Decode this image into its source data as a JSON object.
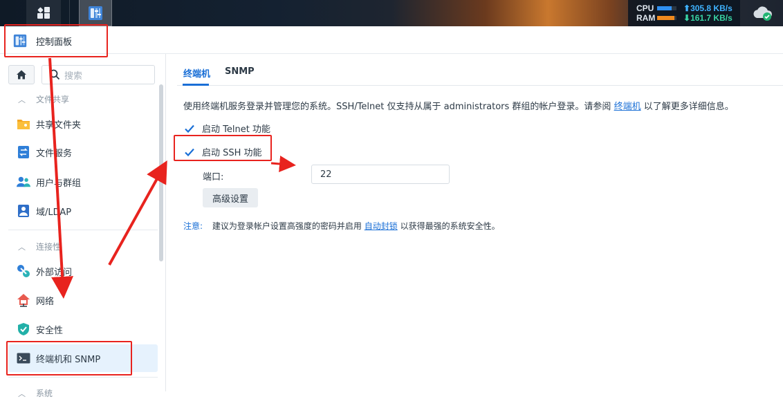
{
  "taskbar": {
    "monitor": {
      "cpu_label": "CPU",
      "ram_label": "RAM",
      "upload_rate": "305.8 KB/s",
      "download_rate": "161.7 KB/s",
      "cpu_fill": 0.75,
      "ram_fill": 0.9
    },
    "icons": [
      "apps-grid-icon",
      "control-panel-icon",
      "cloud-sync-icon"
    ]
  },
  "window": {
    "title": "控制面板"
  },
  "sidebar": {
    "search_placeholder": "搜索",
    "groups": [
      {
        "label": "文件共享"
      },
      {
        "label": "连接性"
      },
      {
        "label": "系统"
      }
    ],
    "items": [
      {
        "label": "共享文件夹",
        "icon": "shared-folder-icon"
      },
      {
        "label": "文件服务",
        "icon": "file-services-icon"
      },
      {
        "label": "用户与群组",
        "icon": "users-icon"
      },
      {
        "label": "域/LDAP",
        "icon": "domain-icon"
      },
      {
        "label": "外部访问",
        "icon": "external-access-icon"
      },
      {
        "label": "网络",
        "icon": "network-icon"
      },
      {
        "label": "安全性",
        "icon": "security-icon"
      },
      {
        "label": "终端机和 SNMP",
        "icon": "terminal-icon"
      }
    ]
  },
  "tabs": [
    {
      "label": "终端机",
      "active": true
    },
    {
      "label": "SNMP",
      "active": false
    }
  ],
  "content": {
    "desc_before": "使用终端机服务登录并管理您的系统。SSH/Telnet 仅支持从属于 administrators 群组的帐户登录。请参阅",
    "desc_link": "终端机",
    "desc_after": "以了解更多详细信息。",
    "telnet_label": "启动 Telnet 功能",
    "telnet_checked": true,
    "ssh_label": "启动 SSH 功能",
    "ssh_checked": true,
    "port_label": "端口:",
    "port_value": "22",
    "advanced_button": "高级设置",
    "note_label": "注意:",
    "note_before": "建议为登录帐户设置高强度的密码并启用",
    "note_link": "自动封锁",
    "note_after": "以获得最强的系统安全性。"
  },
  "colors": {
    "accent": "#1a6fd6",
    "annotation": "#e8231e",
    "active_nav_bg": "#e6f2fd"
  }
}
